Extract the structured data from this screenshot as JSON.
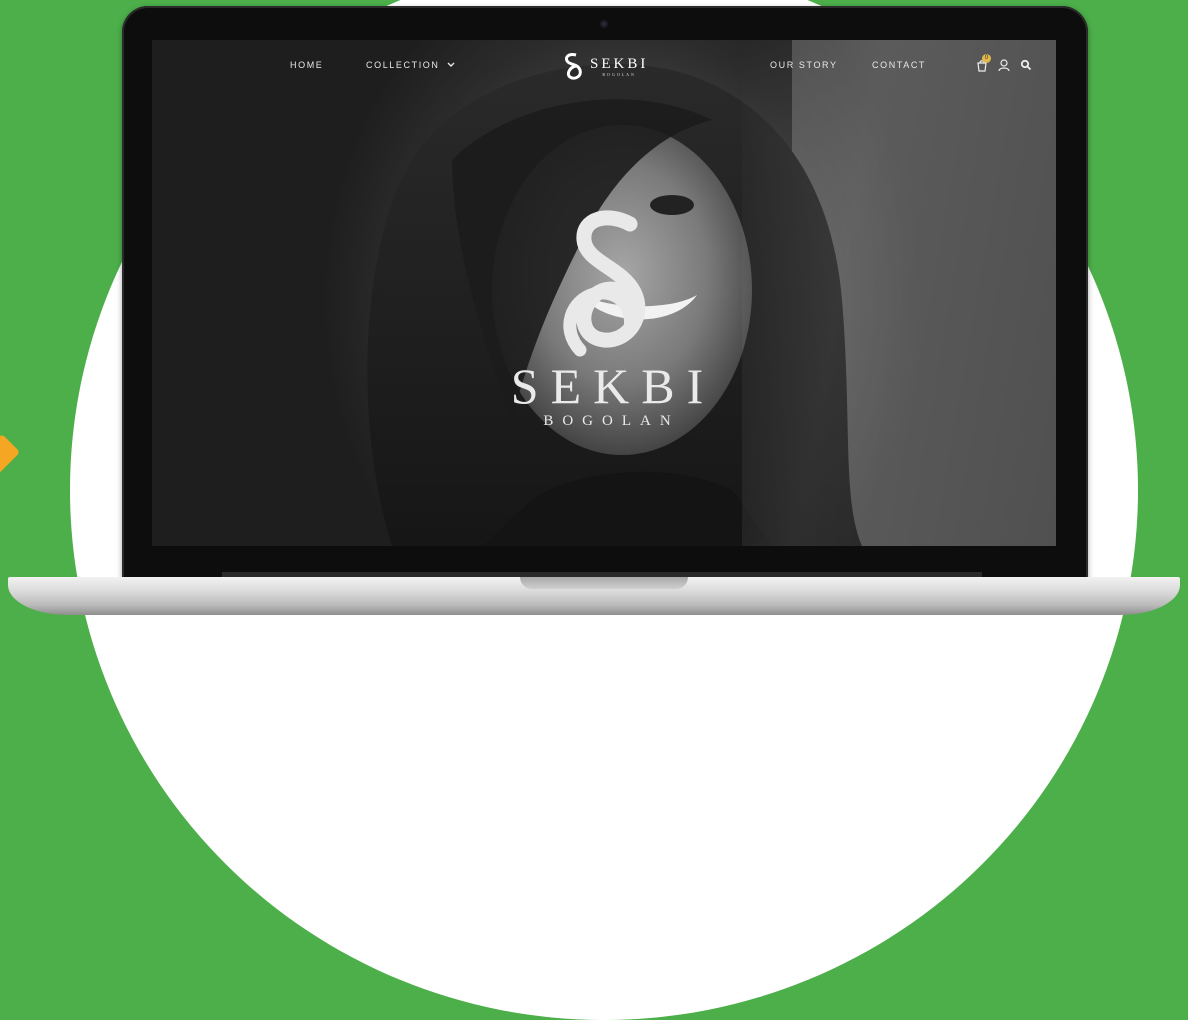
{
  "nav": {
    "links_left": [
      "HOME",
      "COLLECTION"
    ],
    "links_right": [
      "OUR STORY",
      "CONTACT"
    ],
    "cart_count": "0"
  },
  "brand": {
    "name": "SEKBI",
    "sub": "BOGOLAN"
  },
  "hero": {
    "name": "SEKBI",
    "sub": "BOGOLAN"
  },
  "colors": {
    "background": "#4caf4a",
    "accent_badge": "#e0b94a"
  },
  "icons": [
    "chevron-down-icon",
    "cart-icon",
    "user-icon",
    "search-icon"
  ]
}
